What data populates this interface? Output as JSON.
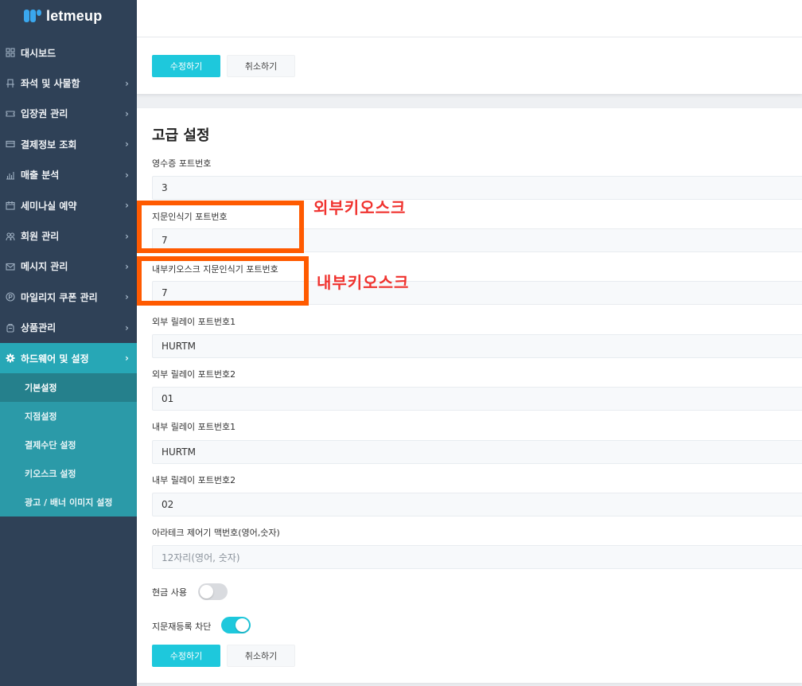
{
  "brand": {
    "name": "letmeup"
  },
  "sidebar": {
    "items": [
      {
        "label": "대시보드",
        "icon": "dashboard-icon",
        "has_children": false
      },
      {
        "label": "좌석 및 사물함",
        "icon": "seat-icon",
        "has_children": true
      },
      {
        "label": "입장권 관리",
        "icon": "ticket-icon",
        "has_children": true
      },
      {
        "label": "결제정보 조회",
        "icon": "card-icon",
        "has_children": true
      },
      {
        "label": "매출 분석",
        "icon": "bar-chart-icon",
        "has_children": true
      },
      {
        "label": "세미나실 예약",
        "icon": "calendar-icon",
        "has_children": true
      },
      {
        "label": "회원 관리",
        "icon": "users-icon",
        "has_children": true
      },
      {
        "label": "메시지 관리",
        "icon": "mail-icon",
        "has_children": true
      },
      {
        "label": "마일리지 쿠폰 관리",
        "icon": "point-icon",
        "has_children": true
      },
      {
        "label": "상품관리",
        "icon": "product-icon",
        "has_children": true
      },
      {
        "label": "하드웨어 및 설정",
        "icon": "gear-icon",
        "has_children": true,
        "active": true
      }
    ],
    "sub_items": [
      {
        "label": "기본설정",
        "current": true
      },
      {
        "label": "지점설정"
      },
      {
        "label": "결제수단 설정"
      },
      {
        "label": "키오스크 설정"
      },
      {
        "label": "광고 / 배너 이미지 설정"
      }
    ]
  },
  "top_actions": {
    "save_label": "수정하기",
    "cancel_label": "취소하기"
  },
  "section": {
    "title": "고급 설정",
    "fields": [
      {
        "label": "영수증 포트번호",
        "value": "3"
      },
      {
        "label": "지문인식기 포트번호",
        "value": "7"
      },
      {
        "label": "내부키오스크 지문인식기 포트번호",
        "value": "7"
      },
      {
        "label": "외부 릴레이 포트번호1",
        "value": "HURTM"
      },
      {
        "label": "외부 릴레이 포트번호2",
        "value": "01"
      },
      {
        "label": "내부 릴레이 포트번호1",
        "value": "HURTM"
      },
      {
        "label": "내부 릴레이 포트번호2",
        "value": "02"
      },
      {
        "label": "아라테크 제어기 맥번호(영어,숫자)",
        "value": "",
        "placeholder": "12자리(영어, 숫자)"
      }
    ],
    "toggles": [
      {
        "label": "현금 사용",
        "on": false
      },
      {
        "label": "지문재등록 차단",
        "on": true
      }
    ]
  },
  "bottom_actions": {
    "save_label": "수정하기",
    "cancel_label": "취소하기"
  },
  "annotations": [
    {
      "text": "외부키오스크"
    },
    {
      "text": "내부키오스크"
    }
  ],
  "colors": {
    "sidebar_bg": "#2f4157",
    "accent": "#1ec8dc",
    "active_menu": "#27a7b6",
    "annotation_box": "#ff5a00",
    "annotation_text": "#f0322e"
  }
}
